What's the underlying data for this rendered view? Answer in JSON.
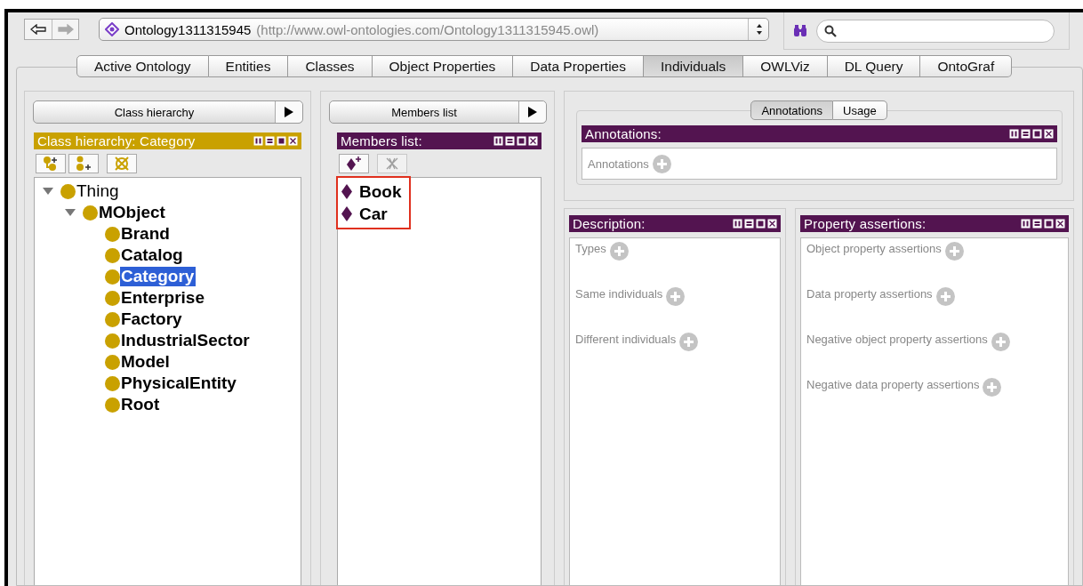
{
  "toolbar": {
    "back_enabled": true,
    "forward_enabled": false,
    "ontology": {
      "name": "Ontology1311315945",
      "iri": "(http://www.owl-ontologies.com/Ontology1311315945.owl)"
    }
  },
  "tabs": [
    {
      "label": "Active Ontology",
      "selected": false
    },
    {
      "label": "Entities",
      "selected": false
    },
    {
      "label": "Classes",
      "selected": false
    },
    {
      "label": "Object Properties",
      "selected": false
    },
    {
      "label": "Data Properties",
      "selected": false
    },
    {
      "label": "Individuals",
      "selected": true
    },
    {
      "label": "OWLViz",
      "selected": false
    },
    {
      "label": "DL Query",
      "selected": false
    },
    {
      "label": "OntoGraf",
      "selected": false
    }
  ],
  "class_panel": {
    "selector": "Class hierarchy",
    "view": {
      "title": "Class hierarchy: Category",
      "kind": "class"
    },
    "tree": [
      {
        "label": "Thing",
        "bold": false,
        "expanded": true,
        "selected": false,
        "children": [
          {
            "label": "MObject",
            "bold": true,
            "expanded": true,
            "selected": false,
            "children": [
              {
                "label": "Brand",
                "bold": true,
                "selected": false
              },
              {
                "label": "Catalog",
                "bold": true,
                "selected": false
              },
              {
                "label": "Category",
                "bold": true,
                "selected": true
              },
              {
                "label": "Enterprise",
                "bold": true,
                "selected": false
              },
              {
                "label": "Factory",
                "bold": true,
                "selected": false
              },
              {
                "label": "IndustrialSector",
                "bold": true,
                "selected": false
              },
              {
                "label": "Model",
                "bold": true,
                "selected": false
              },
              {
                "label": "PhysicalEntity",
                "bold": true,
                "selected": false
              },
              {
                "label": "Root",
                "bold": true,
                "selected": false
              }
            ]
          }
        ]
      }
    ]
  },
  "members_panel": {
    "selector": "Members list",
    "view": {
      "title": "Members list:",
      "kind": "individual"
    },
    "highlighted": true,
    "members": [
      {
        "label": "Book"
      },
      {
        "label": "Car"
      }
    ]
  },
  "detail_tabs": [
    {
      "label": "Annotations",
      "selected": true
    },
    {
      "label": "Usage",
      "selected": false
    }
  ],
  "annotations_view": {
    "title": "Annotations:",
    "kind": "individual",
    "sections": [
      "Annotations"
    ]
  },
  "description_view": {
    "title": "Description:",
    "kind": "individual",
    "sections": [
      "Types",
      "Same individuals",
      "Different individuals"
    ]
  },
  "property_view": {
    "title": "Property assertions:",
    "kind": "individual",
    "sections": [
      "Object property assertions",
      "Data property assertions",
      "Negative object property assertions",
      "Negative data property assertions"
    ]
  }
}
